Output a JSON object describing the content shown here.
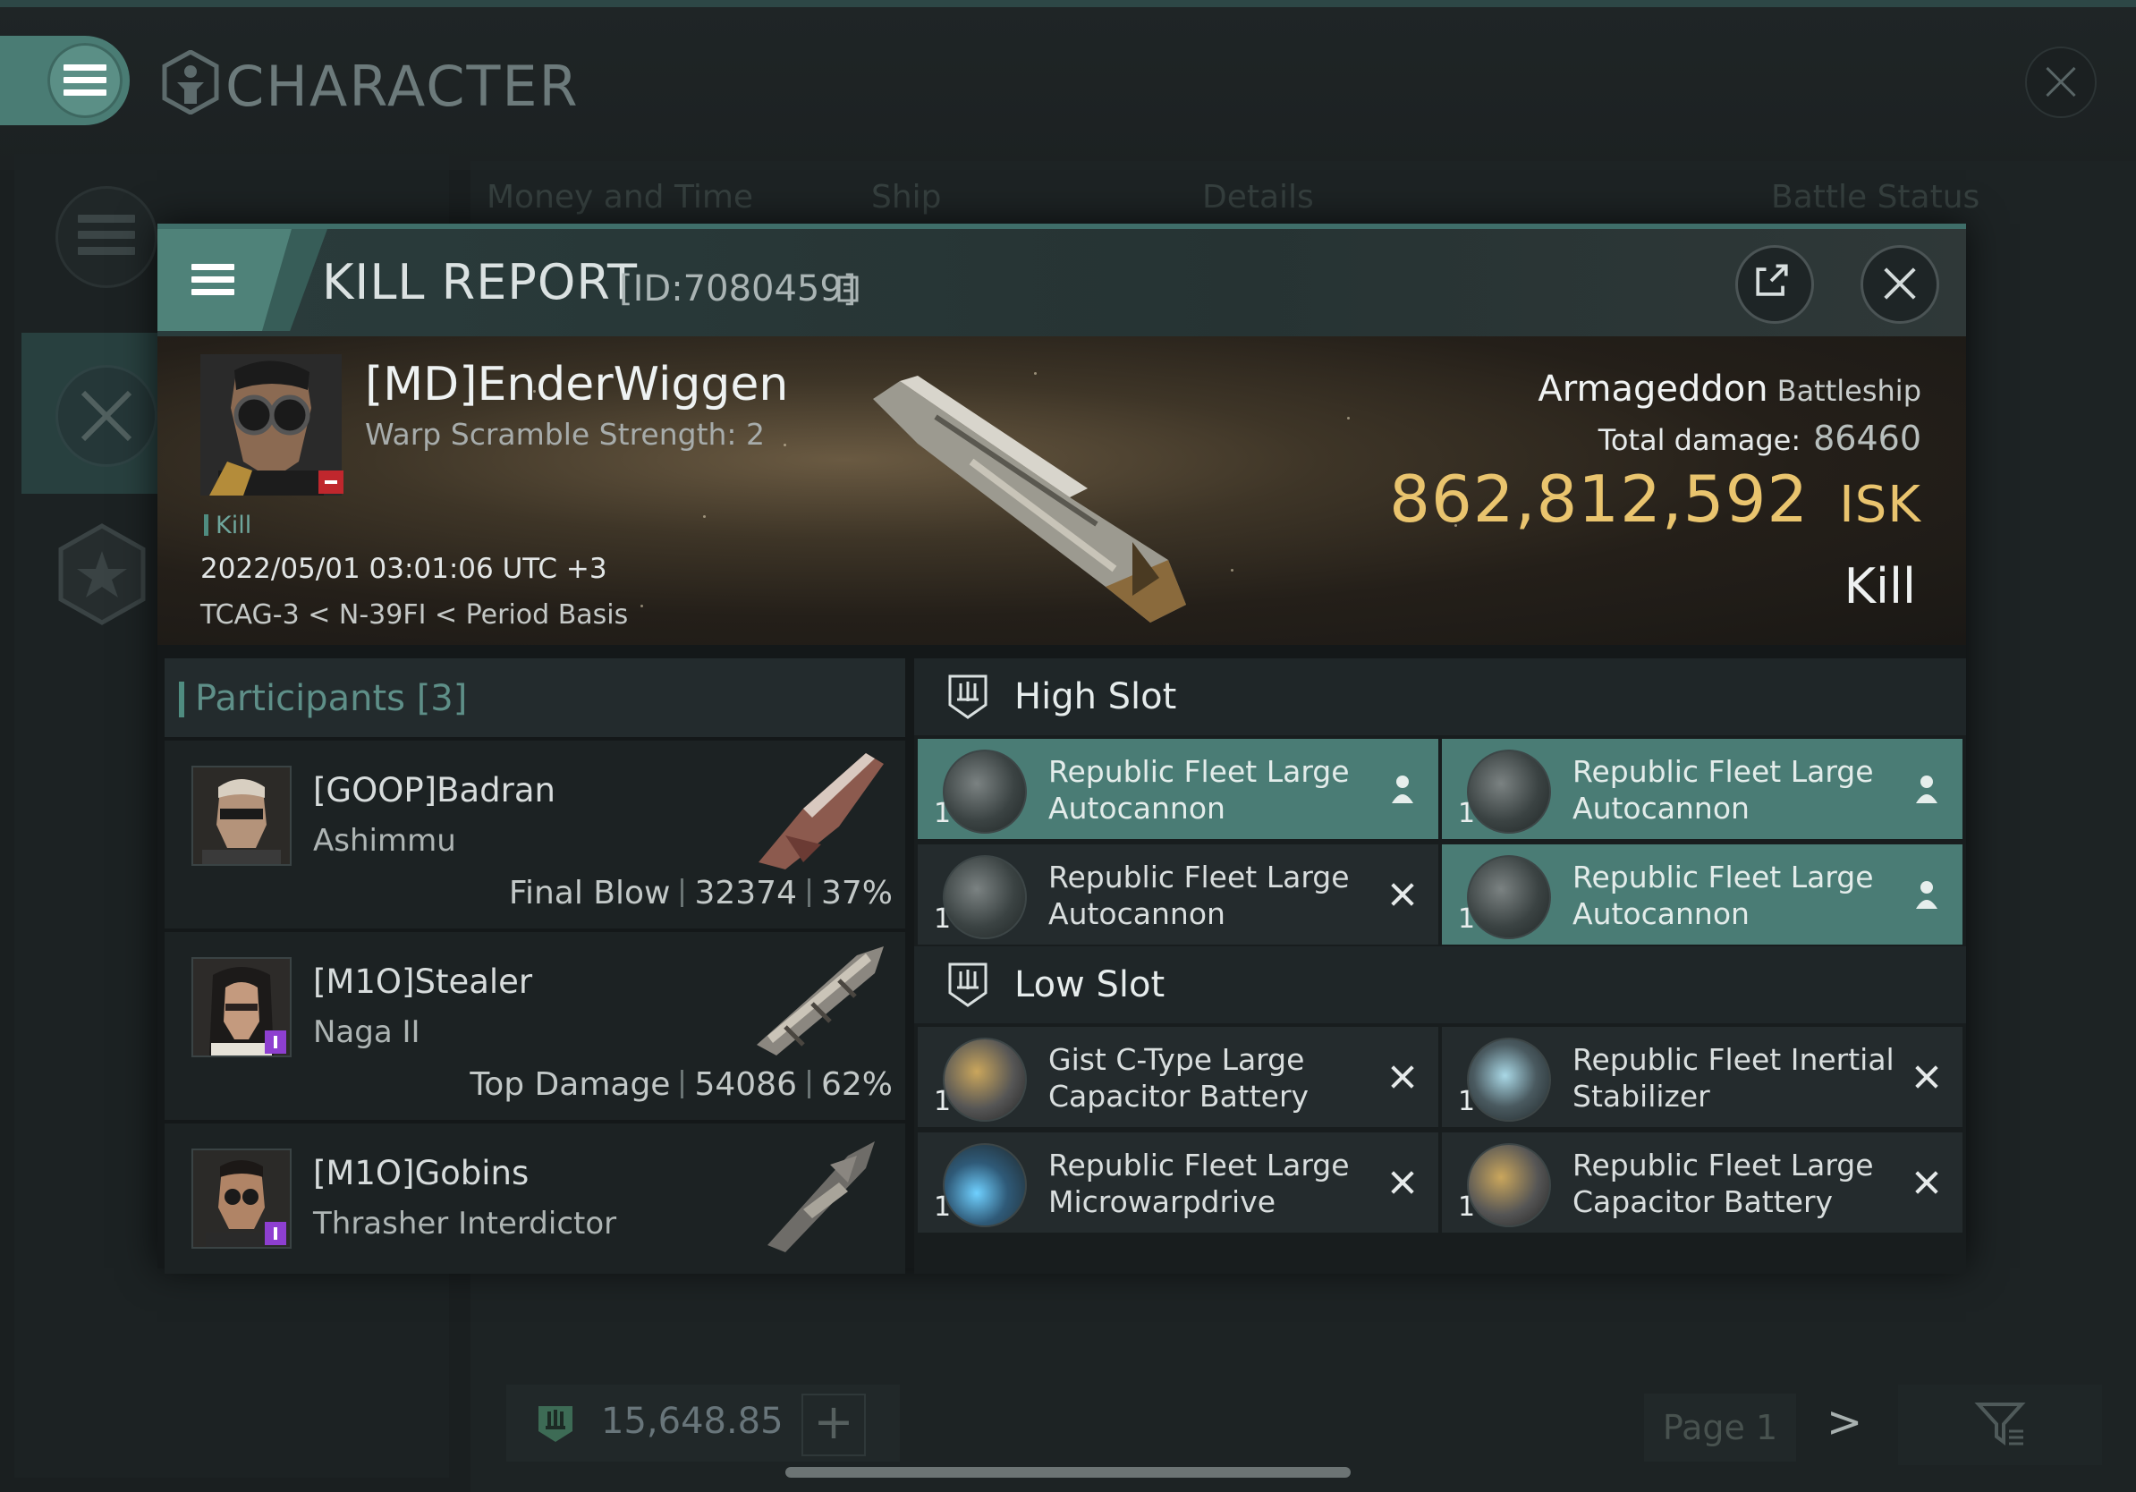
{
  "app": {
    "title": "CHARACTER",
    "background_tabs": [
      "Money and Time",
      "Ship",
      "Details",
      "Battle Status"
    ],
    "wallet_value": "15,648.85",
    "wallet_add_icon": "plus-icon",
    "page_label": "Page 1",
    "next_icon": "chevron-right-icon",
    "filter_icon": "filter-icon"
  },
  "modal": {
    "title": "KILL REPORT",
    "report_id": "[ID:7080459]",
    "accent": "#4f8279"
  },
  "victim": {
    "name": "[MD]EnderWiggen",
    "warp_scramble": "Warp Scramble Strength: 2",
    "tag": "Kill",
    "time": "2022/05/01 03:01:06 UTC +3",
    "location": "TCAG-3 < N-39FI < Period Basis",
    "ship": "Armageddon",
    "ship_class": "Battleship",
    "total_damage_label": "Total damage:",
    "total_damage": "86460",
    "isk_value": "862,812,592",
    "isk_unit": "ISK",
    "result": "Kill",
    "isk_color": "#e9c46e"
  },
  "participants": {
    "label": "Participants",
    "count": "[3]",
    "rows": [
      {
        "name": "[GOOP]Badran",
        "ship": "Ashimmu",
        "stat_label": "Final Blow",
        "damage": "32374",
        "percent": "37%"
      },
      {
        "name": "[M1O]Stealer",
        "ship": "Naga II",
        "stat_label": "Top Damage",
        "damage": "54086",
        "percent": "62%"
      },
      {
        "name": "[M1O]Gobins",
        "ship": "Thrasher Interdictor"
      }
    ]
  },
  "fitting": {
    "high_slot_label": "High Slot",
    "low_slot_label": "Low Slot",
    "high": [
      {
        "qty": "1",
        "name": "Republic Fleet Large Autocannon",
        "state": "person-icon"
      },
      {
        "qty": "1",
        "name": "Republic Fleet Large Autocannon",
        "state": "person-icon"
      },
      {
        "qty": "1",
        "name": "Republic Fleet Large Autocannon",
        "state": "destroyed-x-icon"
      },
      {
        "qty": "1",
        "name": "Republic Fleet Large Autocannon",
        "state": "person-icon"
      }
    ],
    "low": [
      {
        "qty": "1",
        "name": "Gist C-Type Large Capacitor Battery",
        "state": "destroyed-x-icon"
      },
      {
        "qty": "1",
        "name": "Republic Fleet Inertial Stabilizer",
        "state": "destroyed-x-icon"
      },
      {
        "qty": "1",
        "name": "Republic Fleet Large Microwarpdrive",
        "state": "destroyed-x-icon"
      },
      {
        "qty": "1",
        "name": "Republic Fleet Large Capacitor Battery",
        "state": "destroyed-x-icon"
      }
    ]
  }
}
